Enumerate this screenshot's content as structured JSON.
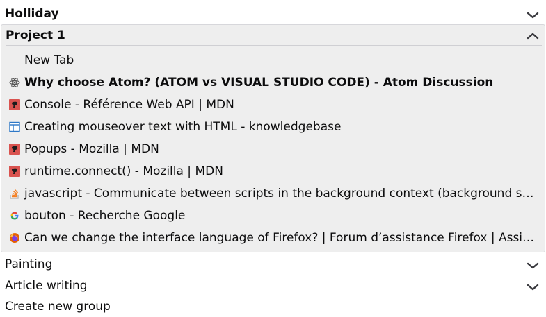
{
  "groups": [
    {
      "name": "Holliday",
      "expanded": false
    },
    {
      "name": "Project 1",
      "expanded": true,
      "tabs": [
        {
          "title": "New Tab",
          "icon": "none",
          "active": false
        },
        {
          "title": "Why choose Atom? (ATOM vs VISUAL STUDIO CODE) - Atom Discussion",
          "icon": "atom-icon",
          "active": true
        },
        {
          "title": "Console - Référence Web API | MDN",
          "icon": "mdn-icon",
          "active": false
        },
        {
          "title": "Creating mouseover text with HTML - knowledgebase",
          "icon": "layout-icon",
          "active": false
        },
        {
          "title": "Popups - Mozilla | MDN",
          "icon": "mdn-icon",
          "active": false
        },
        {
          "title": "runtime.connect() - Mozilla | MDN",
          "icon": "mdn-icon",
          "active": false
        },
        {
          "title": "javascript - Communicate between scripts in the background context (background script, browser action, page action, options page, etc.)",
          "icon": "stackoverflow-icon",
          "active": false
        },
        {
          "title": "bouton - Recherche Google",
          "icon": "google-icon",
          "active": false
        },
        {
          "title": "Can we change the interface language of Firefox? | Forum d’assistance Firefox | Assistance de Mozilla",
          "icon": "firefox-icon",
          "active": false
        }
      ]
    },
    {
      "name": "Painting",
      "expanded": false
    },
    {
      "name": "Article writing",
      "expanded": false
    }
  ],
  "create_group_label": "Create new group",
  "colors": {
    "expanded_bg": "#eeeeee",
    "border": "#d7d7db",
    "mdn_red": "#d9534f",
    "chevron": "#38383d"
  }
}
